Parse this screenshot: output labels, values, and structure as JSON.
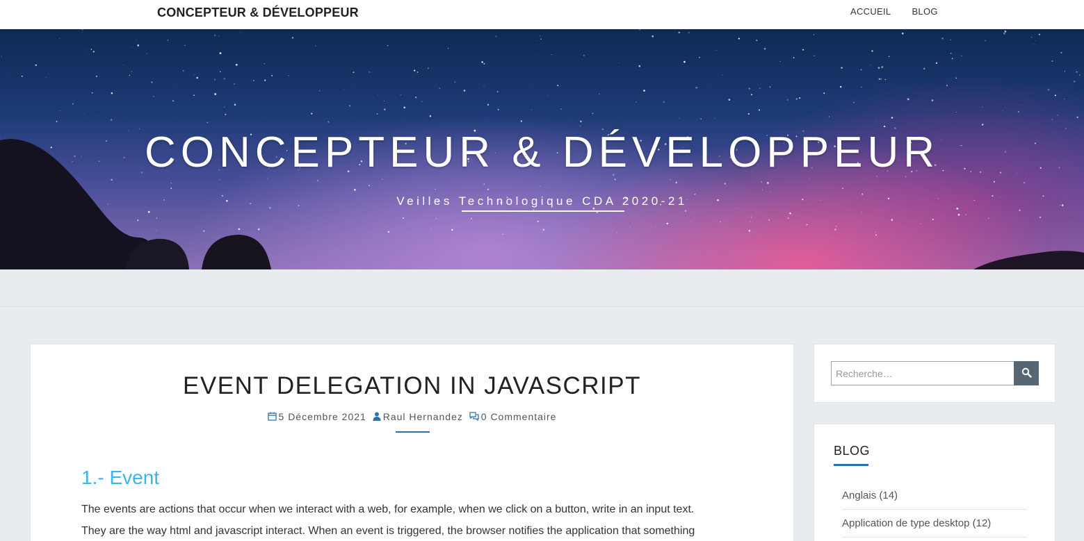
{
  "topbar": {
    "brand": "CONCEPTEUR & DÉVELOPPEUR",
    "nav": [
      "ACCUEIL",
      "BLOG"
    ]
  },
  "hero": {
    "title": "CONCEPTEUR & DÉVELOPPEUR",
    "subtitle": "Veilles Technologique CDA 2020-21"
  },
  "post": {
    "title": "EVENT DELEGATION IN JAVASCRIPT",
    "meta": {
      "date": "5 Décembre 2021",
      "author": "Raul Hernandez",
      "comments": "0 Commentaire"
    },
    "section_heading": "1.- Event",
    "paragraph_lines": [
      "The events are actions that occur when we interact with a web, for example, when we click on a button, write in an input text.",
      "They are the way html and javascript interact. When an event is triggered, the browser notifies the application that something"
    ]
  },
  "sidebar": {
    "search": {
      "placeholder": "Recherche…"
    },
    "blog": {
      "title": "BLOG",
      "categories": [
        "Anglais (14)",
        "Application de type desktop (12)"
      ]
    }
  },
  "colors": {
    "accent": "#2a72b8",
    "heading": "#3bb4e6",
    "page_bg": "#e9ecef",
    "search_button": "#566672"
  }
}
